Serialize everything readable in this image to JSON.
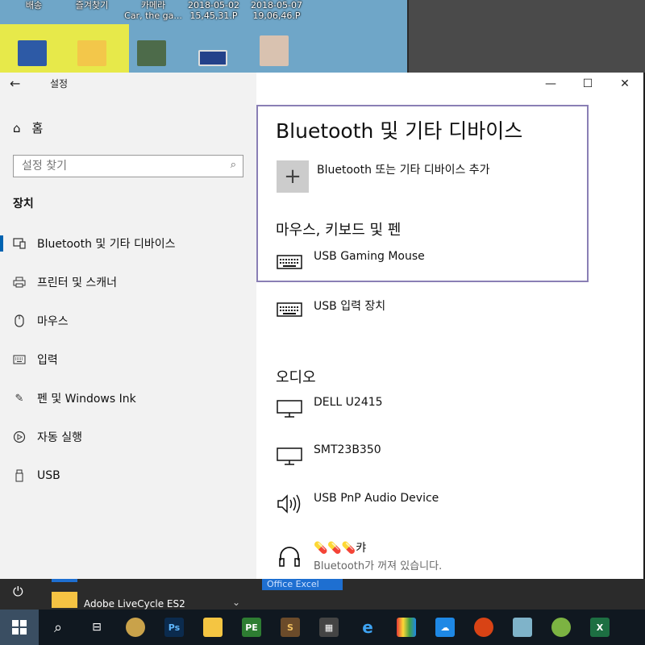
{
  "desktop": {
    "labels": [
      {
        "line1": "배송",
        "line2": ""
      },
      {
        "line1": "즐겨찾기",
        "line2": ""
      },
      {
        "line1": "카메라",
        "line2": "Car, the ga..."
      },
      {
        "line1": "2018-05-02",
        "line2": "15,45,31.P"
      },
      {
        "line1": "2018-05-07",
        "line2": "19,06,46.P"
      }
    ]
  },
  "window": {
    "title": "설정",
    "back_icon": "back-arrow-icon",
    "controls": [
      "minimize",
      "maximize",
      "close"
    ]
  },
  "sidebar": {
    "home_label": "홈",
    "search_placeholder": "설정 찾기",
    "section_title": "장치",
    "items": [
      {
        "label": "Bluetooth 및 기타 디바이스",
        "icon": "bluetooth-devices-icon",
        "active": true
      },
      {
        "label": "프린터 및 스캐너",
        "icon": "printer-icon",
        "active": false
      },
      {
        "label": "마우스",
        "icon": "mouse-icon",
        "active": false
      },
      {
        "label": "입력",
        "icon": "keyboard-icon",
        "active": false
      },
      {
        "label": "펜 및 Windows Ink",
        "icon": "pen-icon",
        "active": false
      },
      {
        "label": "자동 실행",
        "icon": "autoplay-icon",
        "active": false
      },
      {
        "label": "USB",
        "icon": "usb-icon",
        "active": false
      }
    ]
  },
  "main": {
    "title": "Bluetooth 및 기타 디바이스",
    "add_label": "Bluetooth 또는 기타 디바이스 추가",
    "mouse_section": "마우스, 키보드 및 펜",
    "input_devices": [
      {
        "name": "USB Gaming Mouse",
        "icon": "keyboard-icon"
      },
      {
        "name": "USB 입력 장치",
        "icon": "keyboard-icon"
      }
    ],
    "audio_section": "오디오",
    "audio_devices": [
      {
        "name": "DELL U2415",
        "icon": "monitor-icon",
        "status": ""
      },
      {
        "name": "SMT23B350",
        "icon": "monitor-icon",
        "status": ""
      },
      {
        "name": "USB PnP Audio Device",
        "icon": "speaker-icon",
        "status": ""
      },
      {
        "name": "💊💊💊캬",
        "icon": "headphones-icon",
        "status": "Bluetooth가 꺼져 있습니다."
      }
    ]
  },
  "start_menu": {
    "item_label": "Adobe LiveCycle ES2",
    "tile_label": "Office Excel"
  },
  "taskbar": {
    "apps": [
      "windows-start",
      "search",
      "task-view",
      "game",
      "photoshop",
      "file-explorer",
      "app-pe",
      "app-s",
      "calculator",
      "internet-explorer",
      "gallery",
      "cloud",
      "mario",
      "app-folder",
      "app-green",
      "excel"
    ]
  },
  "colors": {
    "accent": "#0063b1",
    "highlight_border": "#8a7fb5",
    "sidebar_bg": "#f2f2f2",
    "taskbar_bg": "#101820"
  }
}
